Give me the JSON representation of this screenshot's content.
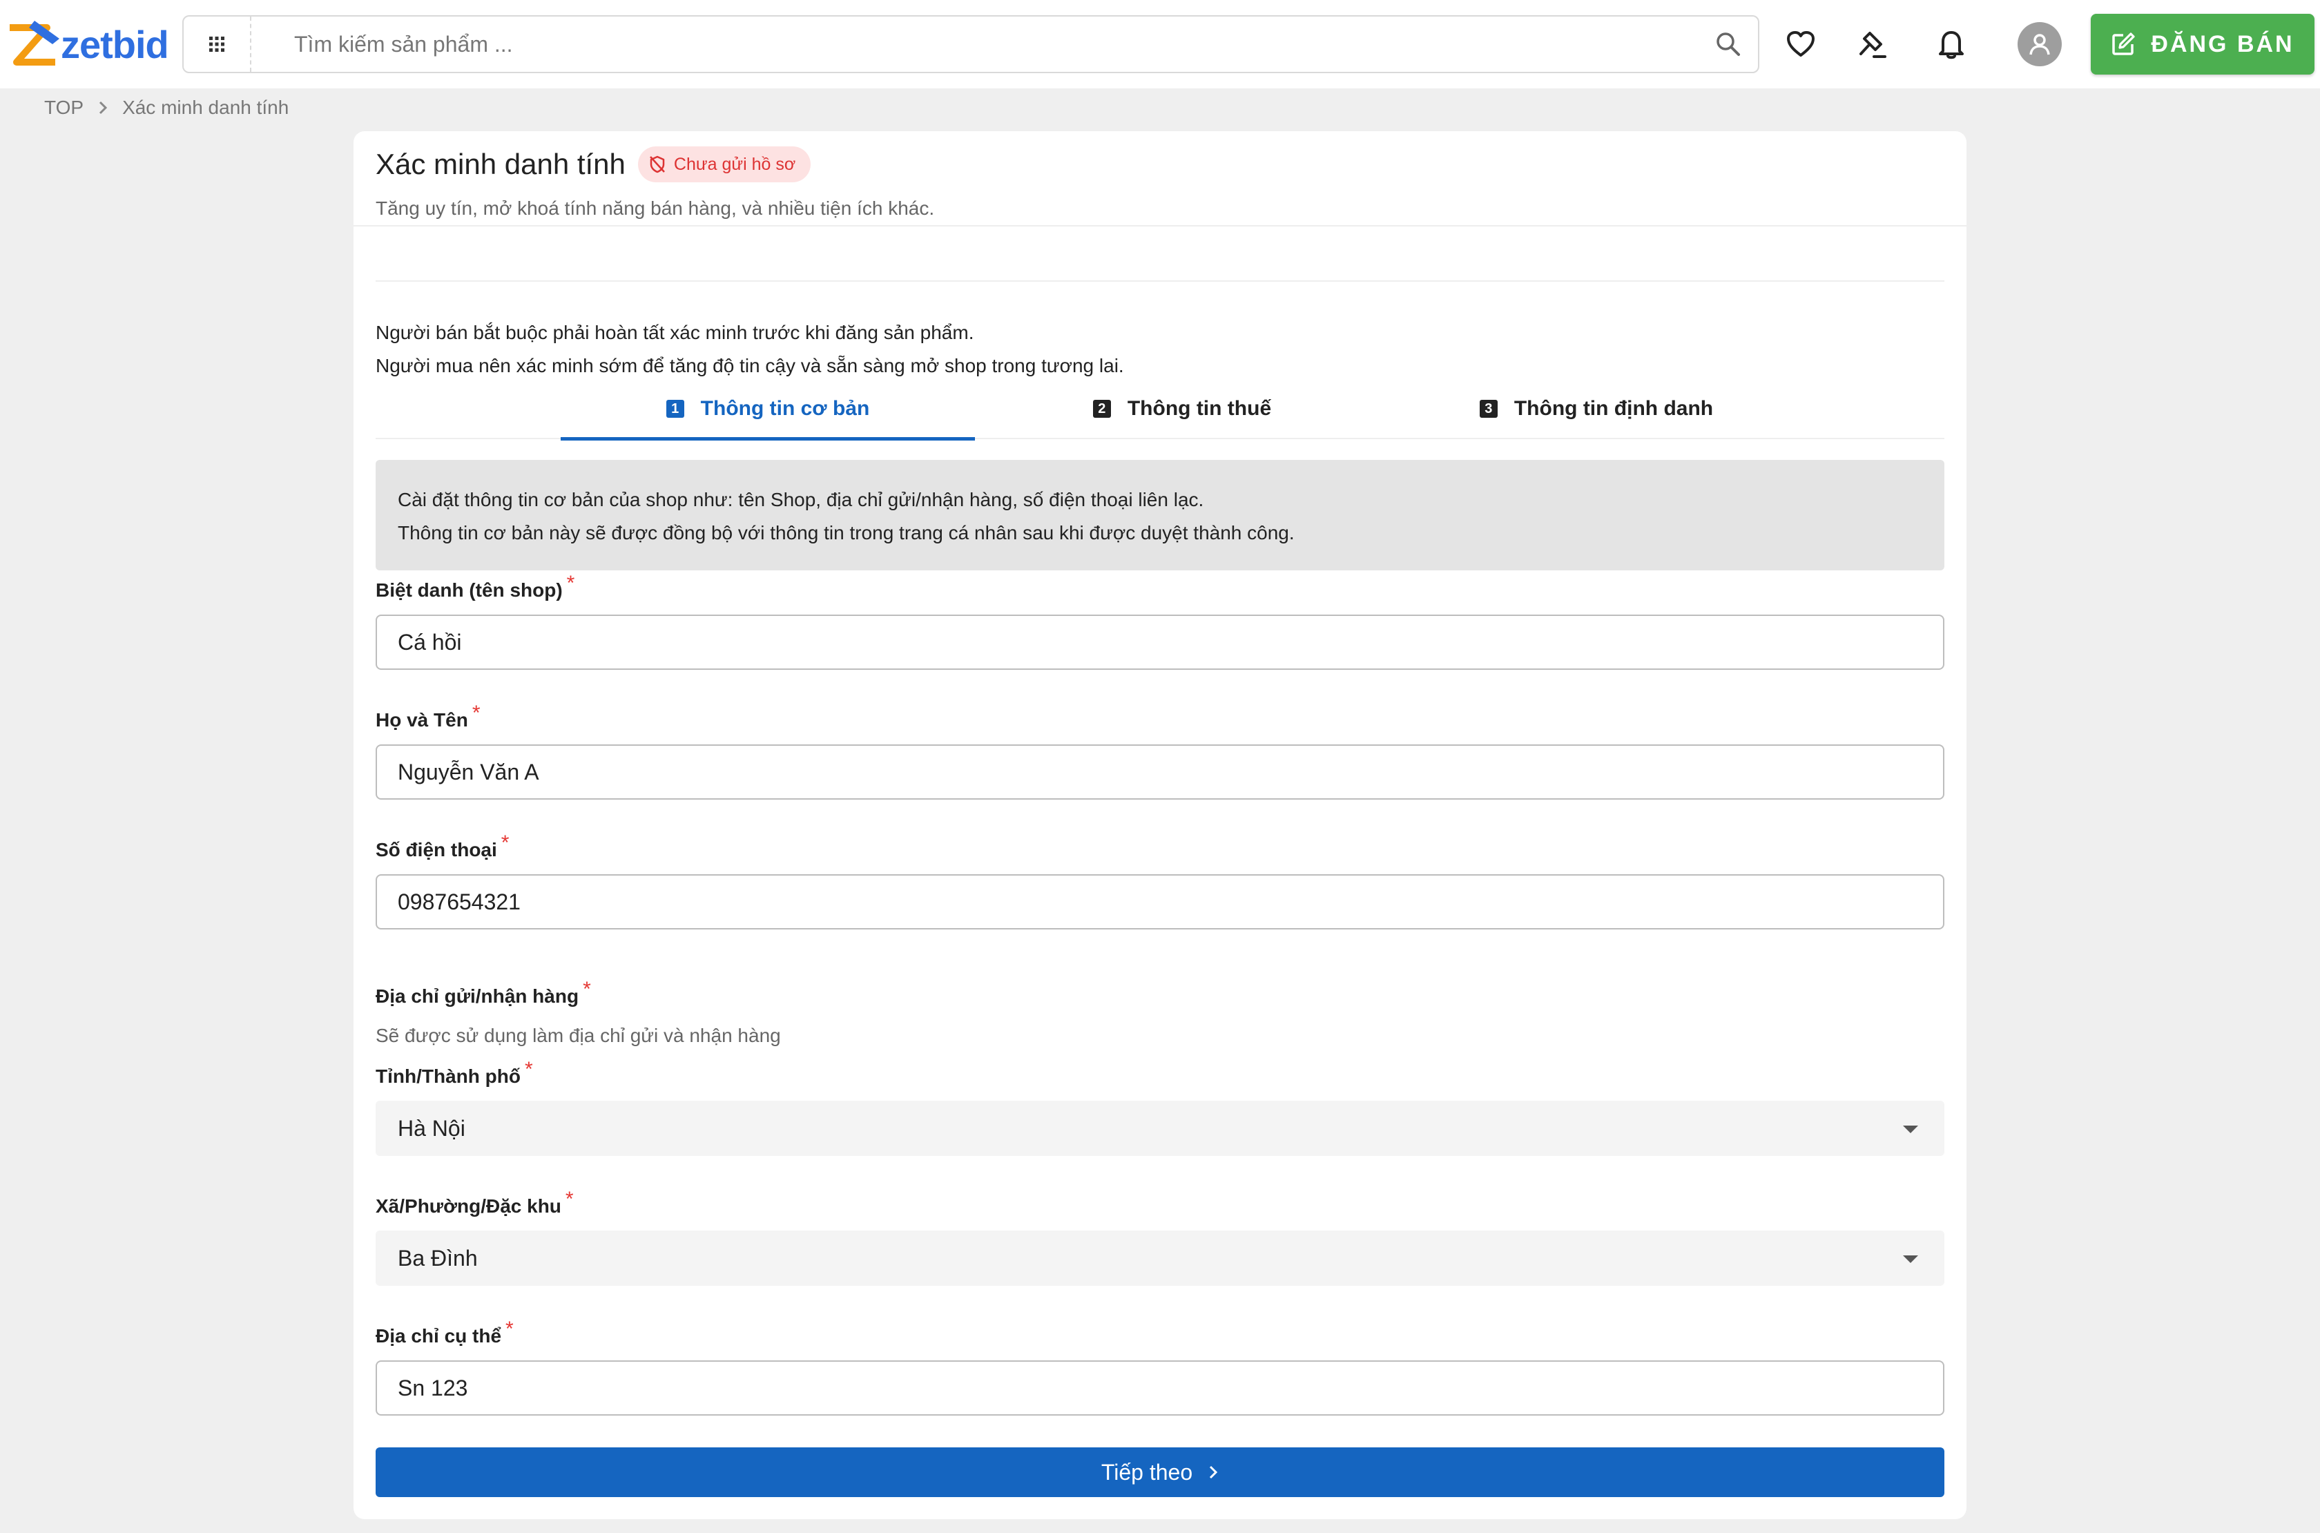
{
  "header": {
    "logo_text": "zetbid",
    "search_placeholder": "Tìm kiếm sản phẩm ...",
    "icons": [
      "apps-grid-icon",
      "search-icon",
      "heart-icon",
      "gavel-icon",
      "bell-icon",
      "user-avatar-icon"
    ],
    "sell_button_label": "ĐĂNG BÁN",
    "sell_button_color": "#4caf50"
  },
  "breadcrumb": {
    "items": [
      "TOP",
      "Xác minh danh tính"
    ]
  },
  "page": {
    "title": "Xác minh danh tính",
    "status_badge": "Chưa gửi hồ sơ",
    "subtitle": "Tăng uy tín, mở khoá tính năng bán hàng, và nhiều tiện ích khác.",
    "intro_lines": [
      "Người bán bắt buộc phải hoàn tất xác minh trước khi đăng sản phẩm.",
      "Người mua nên xác minh sớm để tăng độ tin cậy và sẵn sàng mở shop trong tương lai."
    ],
    "accent_color": "#1565c0"
  },
  "tabs": [
    {
      "number": "1",
      "label": "Thông tin cơ bản",
      "active": true
    },
    {
      "number": "2",
      "label": "Thông tin thuế",
      "active": false
    },
    {
      "number": "3",
      "label": "Thông tin định danh",
      "active": false
    }
  ],
  "info_box": {
    "lines": [
      "Cài đặt thông tin cơ bản của shop như: tên Shop, địa chỉ gửi/nhận hàng, số điện thoại liên lạc.",
      "Thông tin cơ bản này sẽ được đồng bộ với thông tin trong trang cá nhân sau khi được duyệt thành công."
    ]
  },
  "form": {
    "required_mark": "*",
    "nickname": {
      "label": "Biệt danh (tên shop)",
      "value": "Cá hồi"
    },
    "fullname": {
      "label": "Họ và Tên",
      "value": "Nguyễn Văn A"
    },
    "phone": {
      "label": "Số điện thoại",
      "value": "0987654321"
    },
    "address_section": {
      "label": "Địa chỉ gửi/nhận hàng",
      "helper": "Sẽ được sử dụng làm địa chỉ gửi và nhận hàng"
    },
    "province": {
      "label": "Tỉnh/Thành phố",
      "value": "Hà Nội"
    },
    "ward": {
      "label": "Xã/Phường/Đặc khu",
      "value": "Ba Đình"
    },
    "street": {
      "label": "Địa chỉ cụ thể",
      "value": "Sn 123"
    },
    "next_button_label": "Tiếp theo"
  }
}
